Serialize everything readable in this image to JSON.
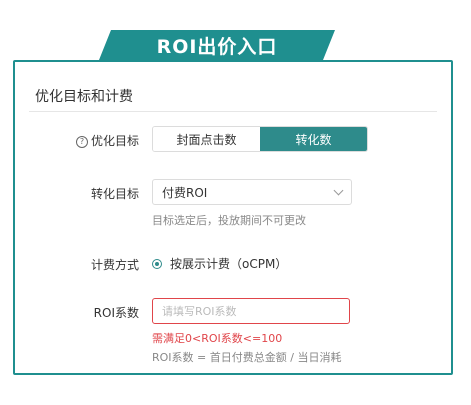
{
  "banner": {
    "title": "ROI出价入口"
  },
  "section": {
    "title": "优化目标和计费"
  },
  "optimization": {
    "label": "优化目标",
    "help": "?",
    "options": [
      "封面点击数",
      "转化数"
    ],
    "selected_index": 1
  },
  "conversion": {
    "label": "转化目标",
    "value": "付费ROI",
    "hint": "目标选定后，投放期间不可更改"
  },
  "billing": {
    "label": "计费方式",
    "option": "按展示计费（oCPM）"
  },
  "roi": {
    "label": "ROI系数",
    "placeholder": "请填写ROI系数",
    "error": "需满足0<ROI系数<=100",
    "formula": "ROI系数 = 首日付费总金额 / 当日消耗"
  },
  "colors": {
    "accent": "#2e8b8b",
    "banner": "#1f8f8f",
    "error": "#e0454a"
  }
}
